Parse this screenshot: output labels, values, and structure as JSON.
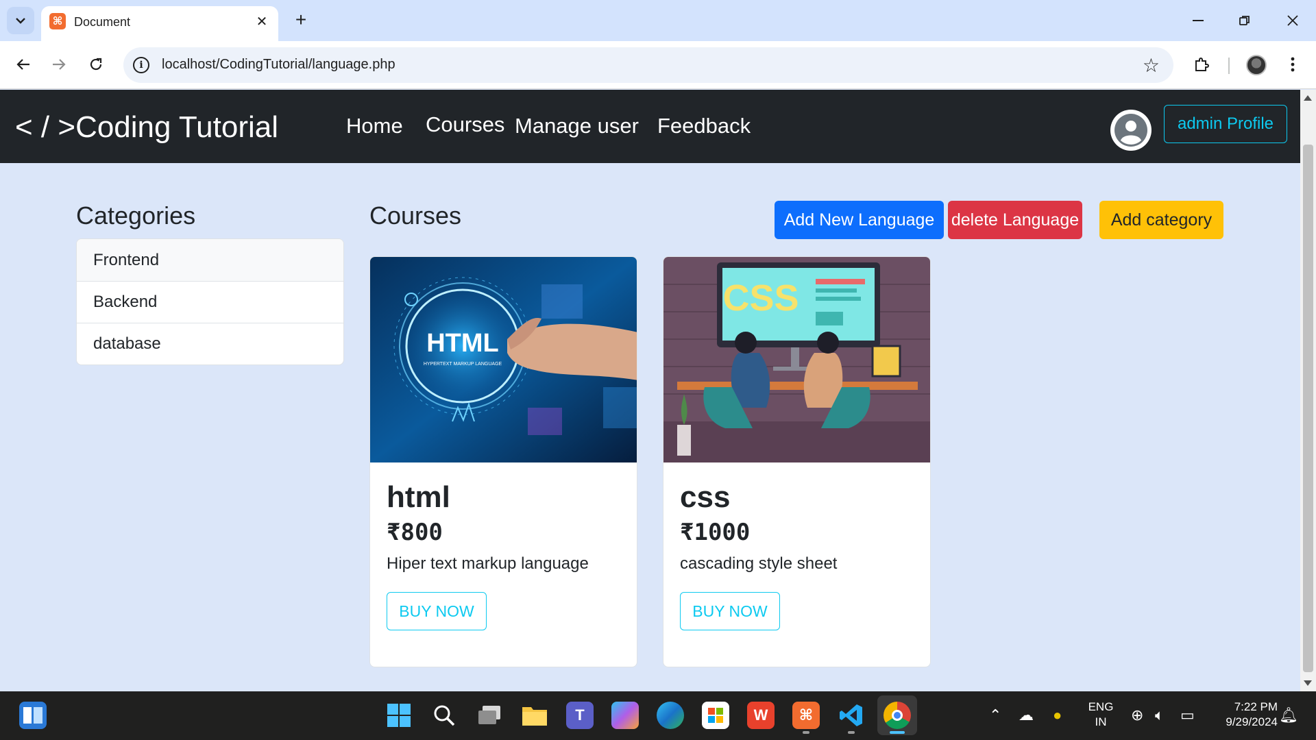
{
  "browser": {
    "tab_title": "Document",
    "url": "localhost/CodingTutorial/language.php"
  },
  "navbar": {
    "brand": "< / >Coding Tutorial",
    "links": [
      "Home",
      "Courses",
      "Manage user",
      "Feedback"
    ],
    "profile_button": "admin Profile"
  },
  "sidebar": {
    "title": "Categories",
    "items": [
      "Frontend",
      "Backend",
      "database"
    ]
  },
  "main": {
    "title": "Courses",
    "actions": {
      "add_language": "Add New Language",
      "delete_language": "delete Language",
      "add_category": "Add category"
    },
    "courses": [
      {
        "name": "html",
        "price": "₹800",
        "description": "Hiper text markup language",
        "button": "BUY NOW",
        "image_text": "HTML",
        "image_subtext": "HYPERTEXT MARKUP LANGUAGE"
      },
      {
        "name": "css",
        "price": "₹1000",
        "description": "cascading style sheet",
        "button": "BUY NOW",
        "image_text": "CSS"
      }
    ]
  },
  "taskbar": {
    "language": "ENG",
    "region": "IN",
    "time": "7:22 PM",
    "date": "9/29/2024"
  },
  "colors": {
    "primary": "#0d6efd",
    "danger": "#dc3545",
    "warning": "#ffc107",
    "info": "#0dcaf0",
    "navbar": "#212529",
    "page_bg": "#dbe6f9"
  }
}
